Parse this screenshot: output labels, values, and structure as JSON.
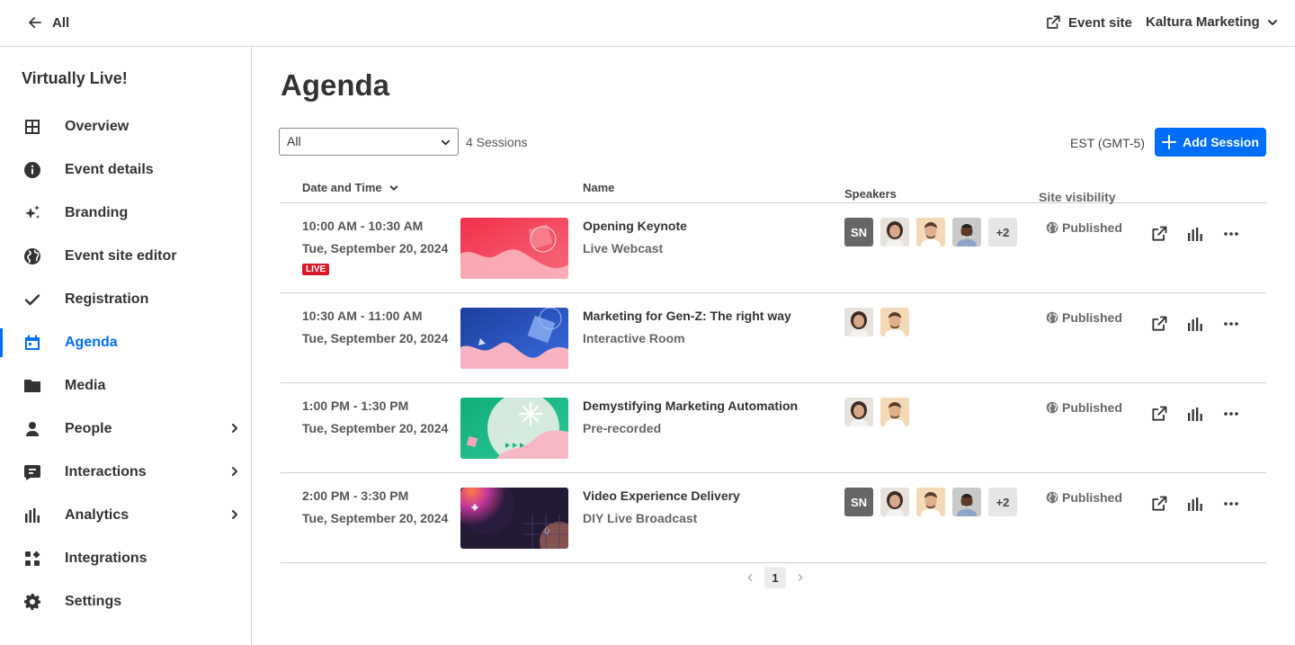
{
  "topbar": {
    "back_label": "All",
    "event_site_label": "Event site",
    "account_label": "Kaltura Marketing"
  },
  "sidebar": {
    "event_name": "Virtually Live!",
    "items": [
      {
        "label": "Overview",
        "icon": "grid-icon"
      },
      {
        "label": "Event details",
        "icon": "info-icon"
      },
      {
        "label": "Branding",
        "icon": "sparkle-icon"
      },
      {
        "label": "Event site editor",
        "icon": "globe-icon"
      },
      {
        "label": "Registration",
        "icon": "check-icon"
      },
      {
        "label": "Agenda",
        "icon": "calendar-icon",
        "active": true
      },
      {
        "label": "Media",
        "icon": "folder-icon"
      },
      {
        "label": "People",
        "icon": "person-icon",
        "expandable": true
      },
      {
        "label": "Interactions",
        "icon": "chat-icon",
        "expandable": true
      },
      {
        "label": "Analytics",
        "icon": "bar-chart-icon",
        "expandable": true
      },
      {
        "label": "Integrations",
        "icon": "integrations-icon"
      },
      {
        "label": "Settings",
        "icon": "gear-icon"
      }
    ]
  },
  "main": {
    "title": "Agenda",
    "filter_value": "All",
    "session_count": "4 Sessions",
    "timezone": "EST (GMT-5)",
    "add_session_label": "Add Session",
    "columns": {
      "date": "Date and Time",
      "name": "Name",
      "speakers": "Speakers",
      "visibility": "Site visibility"
    },
    "sessions": [
      {
        "time": "10:00 AM - 10:30 AM",
        "date": "Tue, September 20, 2024",
        "live_badge": "LIVE",
        "name": "Opening Keynote",
        "type": "Live Webcast",
        "speaker_initials": "SN",
        "more_speakers": "+2",
        "visibility": "Published"
      },
      {
        "time": "10:30 AM - 11:00 AM",
        "date": "Tue, September 20, 2024",
        "name": "Marketing for Gen-Z: The right way",
        "type": "Interactive Room",
        "visibility": "Published"
      },
      {
        "time": "1:00 PM - 1:30 PM",
        "date": "Tue, September 20, 2024",
        "name": "Demystifying Marketing Automation",
        "type": "Pre-recorded",
        "visibility": "Published"
      },
      {
        "time": "2:00 PM - 3:30 PM",
        "date": "Tue, September 20, 2024",
        "name": "Video Experience Delivery",
        "type": "DIY Live Broadcast",
        "speaker_initials": "SN",
        "more_speakers": "+2",
        "visibility": "Published"
      }
    ],
    "pager": {
      "current_page": "1"
    }
  },
  "colors": {
    "accent": "#006efa",
    "live": "#d9192b",
    "text": "#333333"
  }
}
